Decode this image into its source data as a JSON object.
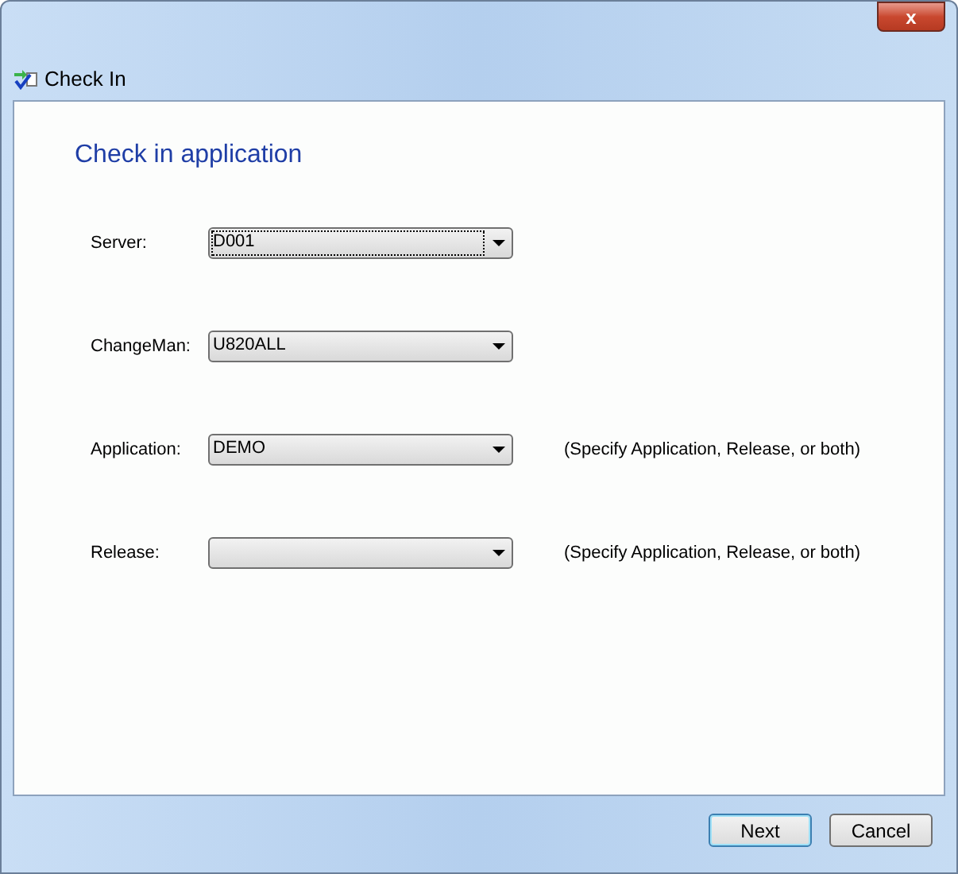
{
  "window": {
    "title": "Check In",
    "close_label": "x"
  },
  "heading": "Check in application",
  "fields": [
    {
      "label": "Server:",
      "value": "D001",
      "focused": true
    },
    {
      "label": "ChangeMan:",
      "value": "U820ALL",
      "focused": false
    },
    {
      "label": "Application:",
      "value": "DEMO",
      "focused": false,
      "hint": "(Specify Application, Release, or both)"
    },
    {
      "label": "Release:",
      "focused": false,
      "hint": "(Specify Application, Release, or both)"
    }
  ],
  "buttons": [
    {
      "label": "Next",
      "default": true
    },
    {
      "label": "Cancel",
      "default": false
    }
  ]
}
